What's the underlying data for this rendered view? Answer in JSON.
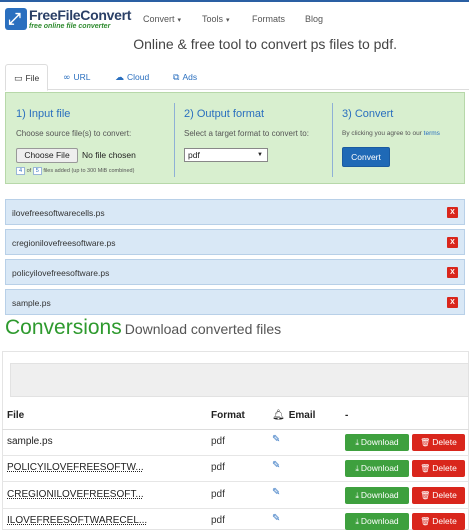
{
  "header": {
    "brand_name": "FreeFileConvert",
    "brand_tagline": "free online file converter",
    "nav": [
      {
        "label": "Convert",
        "dropdown": true
      },
      {
        "label": "Tools",
        "dropdown": true
      },
      {
        "label": "Formats",
        "dropdown": false
      },
      {
        "label": "Blog",
        "dropdown": false
      }
    ],
    "accent_color": "#2a6fbf"
  },
  "tagline": "Online & free tool to convert ps files to pdf.",
  "tabs": [
    {
      "label": "File",
      "icon": "monitor-icon",
      "active": true
    },
    {
      "label": "URL",
      "icon": "link-icon",
      "active": false
    },
    {
      "label": "Cloud",
      "icon": "cloud-icon",
      "active": false
    },
    {
      "label": "Ads",
      "icon": "external-link-icon",
      "active": false
    }
  ],
  "panel": {
    "step1_title": "1) Input file",
    "step1_text": "Choose source file(s) to convert:",
    "choose_button": "Choose File",
    "no_file": "No file chosen",
    "files_count": "4",
    "files_max": "5",
    "files_of": "of",
    "files_added": "files added (up to 300 MiB combined)",
    "step2_title": "2) Output format",
    "step2_text": "Select a target format to convert to:",
    "format_value": "pdf",
    "step3_title": "3) Convert",
    "agree_text": "By clicking you agree to our",
    "terms_link": "terms",
    "convert_button": "Convert",
    "panel_color": "#d8efcf"
  },
  "queued_files": [
    "ilovefreesoftwarecells.ps",
    "cregionilovefreesoftware.ps",
    "policyilovefreesoftware.ps",
    "sample.ps"
  ],
  "remove_label": "X",
  "conversions": {
    "title": "Conversions",
    "subtitle": "Download converted files",
    "columns": [
      "File",
      "Format",
      "Email",
      "-"
    ],
    "download_label": "Download",
    "delete_label": "Delete",
    "rows": [
      {
        "file": "sample.ps",
        "format": "pdf"
      },
      {
        "file": "POLICYILOVEFREESOFTW...",
        "format": "pdf"
      },
      {
        "file": "CREGIONILOVEFREESOFT...",
        "format": "pdf"
      },
      {
        "file": "ILOVEFREESOFTWARECEL...",
        "format": "pdf"
      }
    ]
  }
}
